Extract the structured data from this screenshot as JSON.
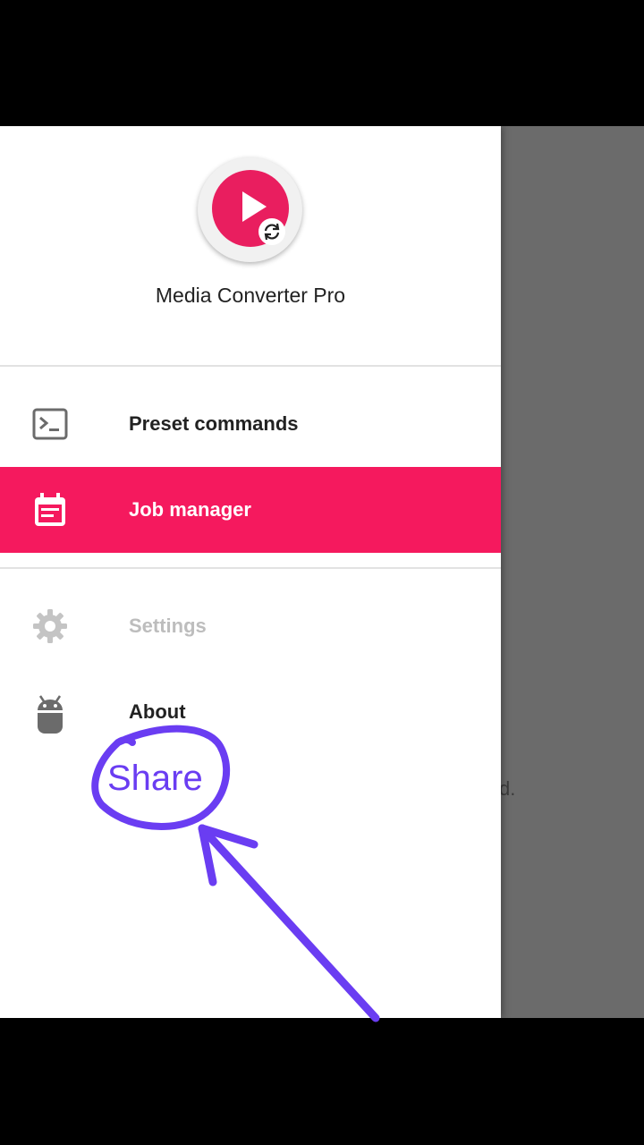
{
  "app": {
    "name": "Media Converter Pro"
  },
  "drawer": {
    "items": [
      {
        "label": "Preset commands",
        "icon": "terminal-icon",
        "state": "normal"
      },
      {
        "label": "Job manager",
        "icon": "calendar-icon",
        "state": "active"
      },
      {
        "label": "Settings",
        "icon": "gear-icon",
        "state": "disabled"
      },
      {
        "label": "About",
        "icon": "android-icon",
        "state": "normal"
      }
    ]
  },
  "background": {
    "partial_text": "d."
  },
  "annotation": {
    "text": "Share",
    "color": "#6a3df2"
  },
  "colors": {
    "accent": "#f5195e",
    "scrim": "#6b6b6b"
  }
}
